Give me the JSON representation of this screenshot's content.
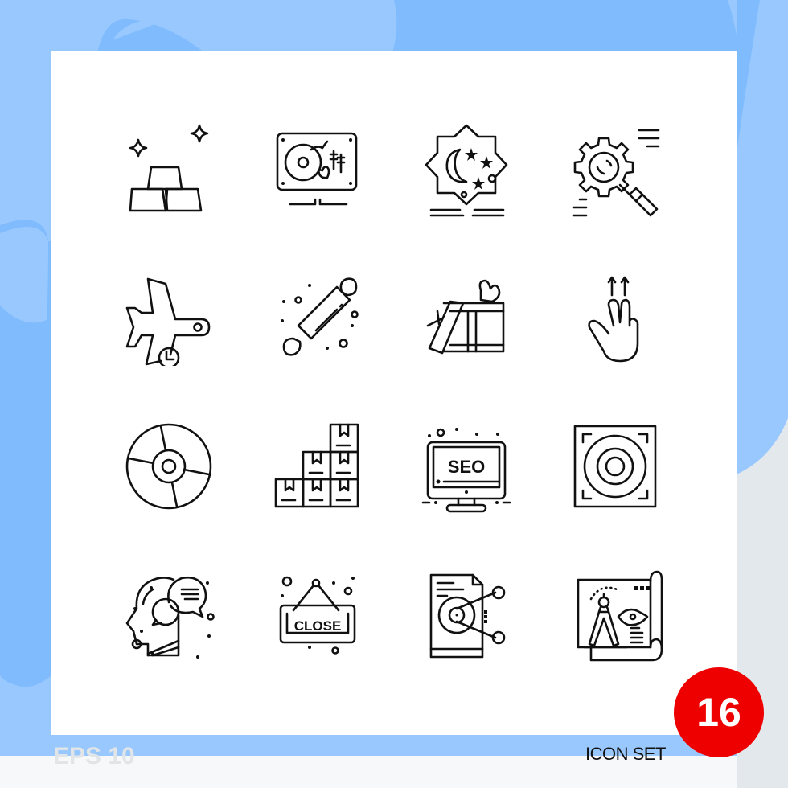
{
  "footer": {
    "format_label": "EPS 10",
    "set_label": "ICON SET",
    "count_badge": "16"
  },
  "colors": {
    "background_light_blue": "#98c8fd",
    "background_mid_blue": "#7fbbfd",
    "card": "#ffffff",
    "badge": "#ee0000",
    "icon_stroke": "#111111",
    "footer_gray": "#e1e5e8"
  },
  "icon_grid": {
    "style": "outline",
    "rows": [
      [
        "gold-bars-icon",
        "turntable-icon",
        "ramadan-moon-icon",
        "gear-search-icon"
      ],
      [
        "flight-delay-icon",
        "rolling-pin-icon",
        "gift-box-icon",
        "two-finger-swipe-up-icon"
      ],
      [
        "cd-disc-icon",
        "stacked-boxes-icon",
        "seo-monitor-icon",
        "speaker-icon"
      ],
      [
        "mind-chat-icon",
        "close-sign-icon",
        "audio-file-share-icon",
        "blueprint-compass-icon"
      ]
    ],
    "labels": {
      "seo": "SEO",
      "close": "CLOSE"
    }
  }
}
